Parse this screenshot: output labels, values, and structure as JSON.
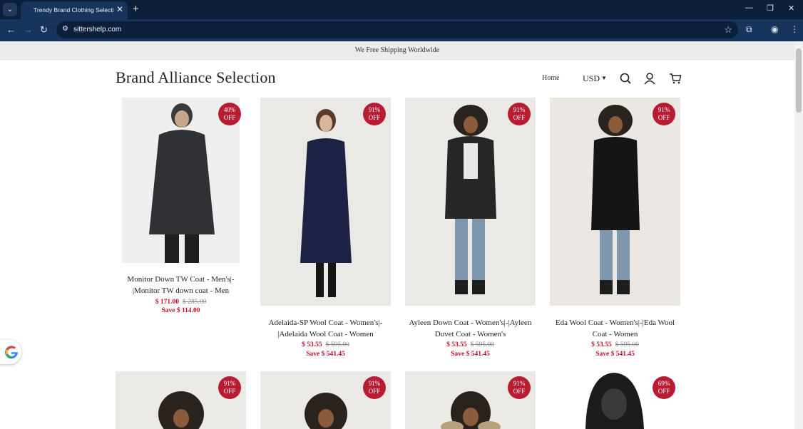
{
  "browser": {
    "tab_title": "Trendy Brand Clothing Selection",
    "url": "sittershelp.com"
  },
  "announcement": "We Free Shipping Worldwide",
  "header": {
    "brand": "Brand Alliance Selection",
    "nav_home": "Home",
    "currency": "USD"
  },
  "products": [
    {
      "name": "Monitor Down TW Coat - Men's|-|Monitor TW down coat - Men",
      "badge_pct": "40%",
      "badge_off": "OFF",
      "price": "$ 171.00",
      "was": "$ 285.00",
      "save": "Save $ 114.00"
    },
    {
      "name": "Adelaida-SP Wool Coat - Women's|-|Adelaida Wool Coat - Women",
      "badge_pct": "91%",
      "badge_off": "OFF",
      "price": "$ 53.55",
      "was": "$ 595.00",
      "save": "Save $ 541.45"
    },
    {
      "name": "Ayleen Down Coat - Women's|-|Ayleen Duvet Coat - Women's",
      "badge_pct": "91%",
      "badge_off": "OFF",
      "price": "$ 53.55",
      "was": "$ 595.00",
      "save": "Save $ 541.45"
    },
    {
      "name": "Eda Wool Coat - Women's|-|Eda Wool Coat - Women",
      "badge_pct": "91%",
      "badge_off": "OFF",
      "price": "$ 53.55",
      "was": "$ 595.00",
      "save": "Save $ 541.45"
    },
    {
      "badge_pct": "91%",
      "badge_off": "OFF"
    },
    {
      "badge_pct": "91%",
      "badge_off": "OFF"
    },
    {
      "badge_pct": "91%",
      "badge_off": "OFF"
    },
    {
      "badge_pct": "69%",
      "badge_off": "OFF"
    }
  ],
  "colors": {
    "accent": "#b81c33",
    "price": "#c3112d",
    "chrome_dark": "#0b1f3a",
    "chrome_toolbar": "#17355c"
  }
}
